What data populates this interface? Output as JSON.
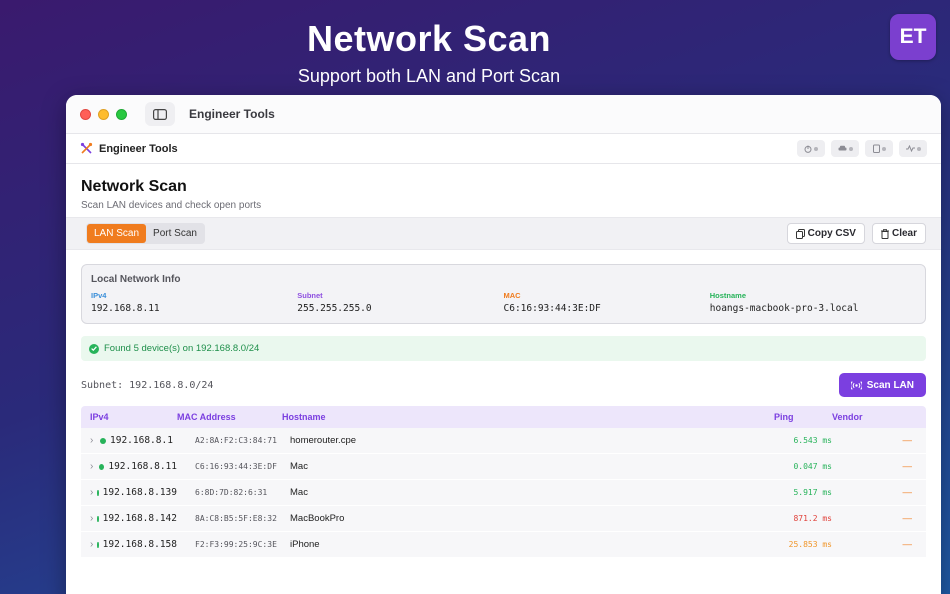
{
  "promo": {
    "title": "Network Scan",
    "subtitle": "Support both LAN and Port Scan",
    "logo_text": "ET"
  },
  "window": {
    "title": "Engineer Tools",
    "traffic_lights": [
      "close",
      "minimize",
      "zoom"
    ]
  },
  "appbar": {
    "brand": "Engineer Tools",
    "brand_icon": "tools-icon",
    "tools": [
      "power-icon",
      "car-icon",
      "clipboard-icon",
      "activity-icon"
    ]
  },
  "page": {
    "title": "Network Scan",
    "subtitle": "Scan LAN devices and check open ports"
  },
  "toolbar": {
    "tabs": [
      {
        "label": "LAN Scan",
        "active": true
      },
      {
        "label": "Port Scan",
        "active": false
      }
    ],
    "copy_csv": "Copy CSV",
    "clear": "Clear"
  },
  "local_info": {
    "title": "Local Network Info",
    "fields": [
      {
        "label": "IPv4",
        "value": "192.168.8.11",
        "color": "#3b8fd9"
      },
      {
        "label": "Subnet",
        "value": "255.255.255.0",
        "color": "#8e4fe0"
      },
      {
        "label": "MAC",
        "value": "C6:16:93:44:3E:DF",
        "color": "#f07c1e"
      },
      {
        "label": "Hostname",
        "value": "hoangs-macbook-pro-3.local",
        "color": "#27b35a"
      }
    ]
  },
  "status": {
    "message": "Found 5 device(s) on 192.168.8.0/24"
  },
  "scan": {
    "subnet_label": "Subnet: 192.168.8.0/24",
    "button": "Scan LAN"
  },
  "table": {
    "columns": [
      "IPv4",
      "MAC Address",
      "Hostname",
      "Ping",
      "Vendor"
    ],
    "rows": [
      {
        "ip": "192.168.8.1",
        "mac": "A2:8A:F2:C3:84:71",
        "host": "homerouter.cpe",
        "ping": "6.543 ms",
        "ping_color": "#27b35a",
        "vendor": "—"
      },
      {
        "ip": "192.168.8.11",
        "mac": "C6:16:93:44:3E:DF",
        "host": "Mac",
        "ping": "0.047 ms",
        "ping_color": "#27b35a",
        "vendor": "—"
      },
      {
        "ip": "192.168.8.139",
        "mac": "6:8D:7D:82:6:31",
        "host": "Mac",
        "ping": "5.917 ms",
        "ping_color": "#27b35a",
        "vendor": "—"
      },
      {
        "ip": "192.168.8.142",
        "mac": "8A:C8:B5:5F:E8:32",
        "host": "MacBookPro",
        "ping": "871.2 ms",
        "ping_color": "#e0413a",
        "vendor": "—"
      },
      {
        "ip": "192.168.8.158",
        "mac": "F2:F3:99:25:9C:3E",
        "host": "iPhone",
        "ping": "25.853 ms",
        "ping_color": "#f0962a",
        "vendor": "—"
      }
    ]
  }
}
